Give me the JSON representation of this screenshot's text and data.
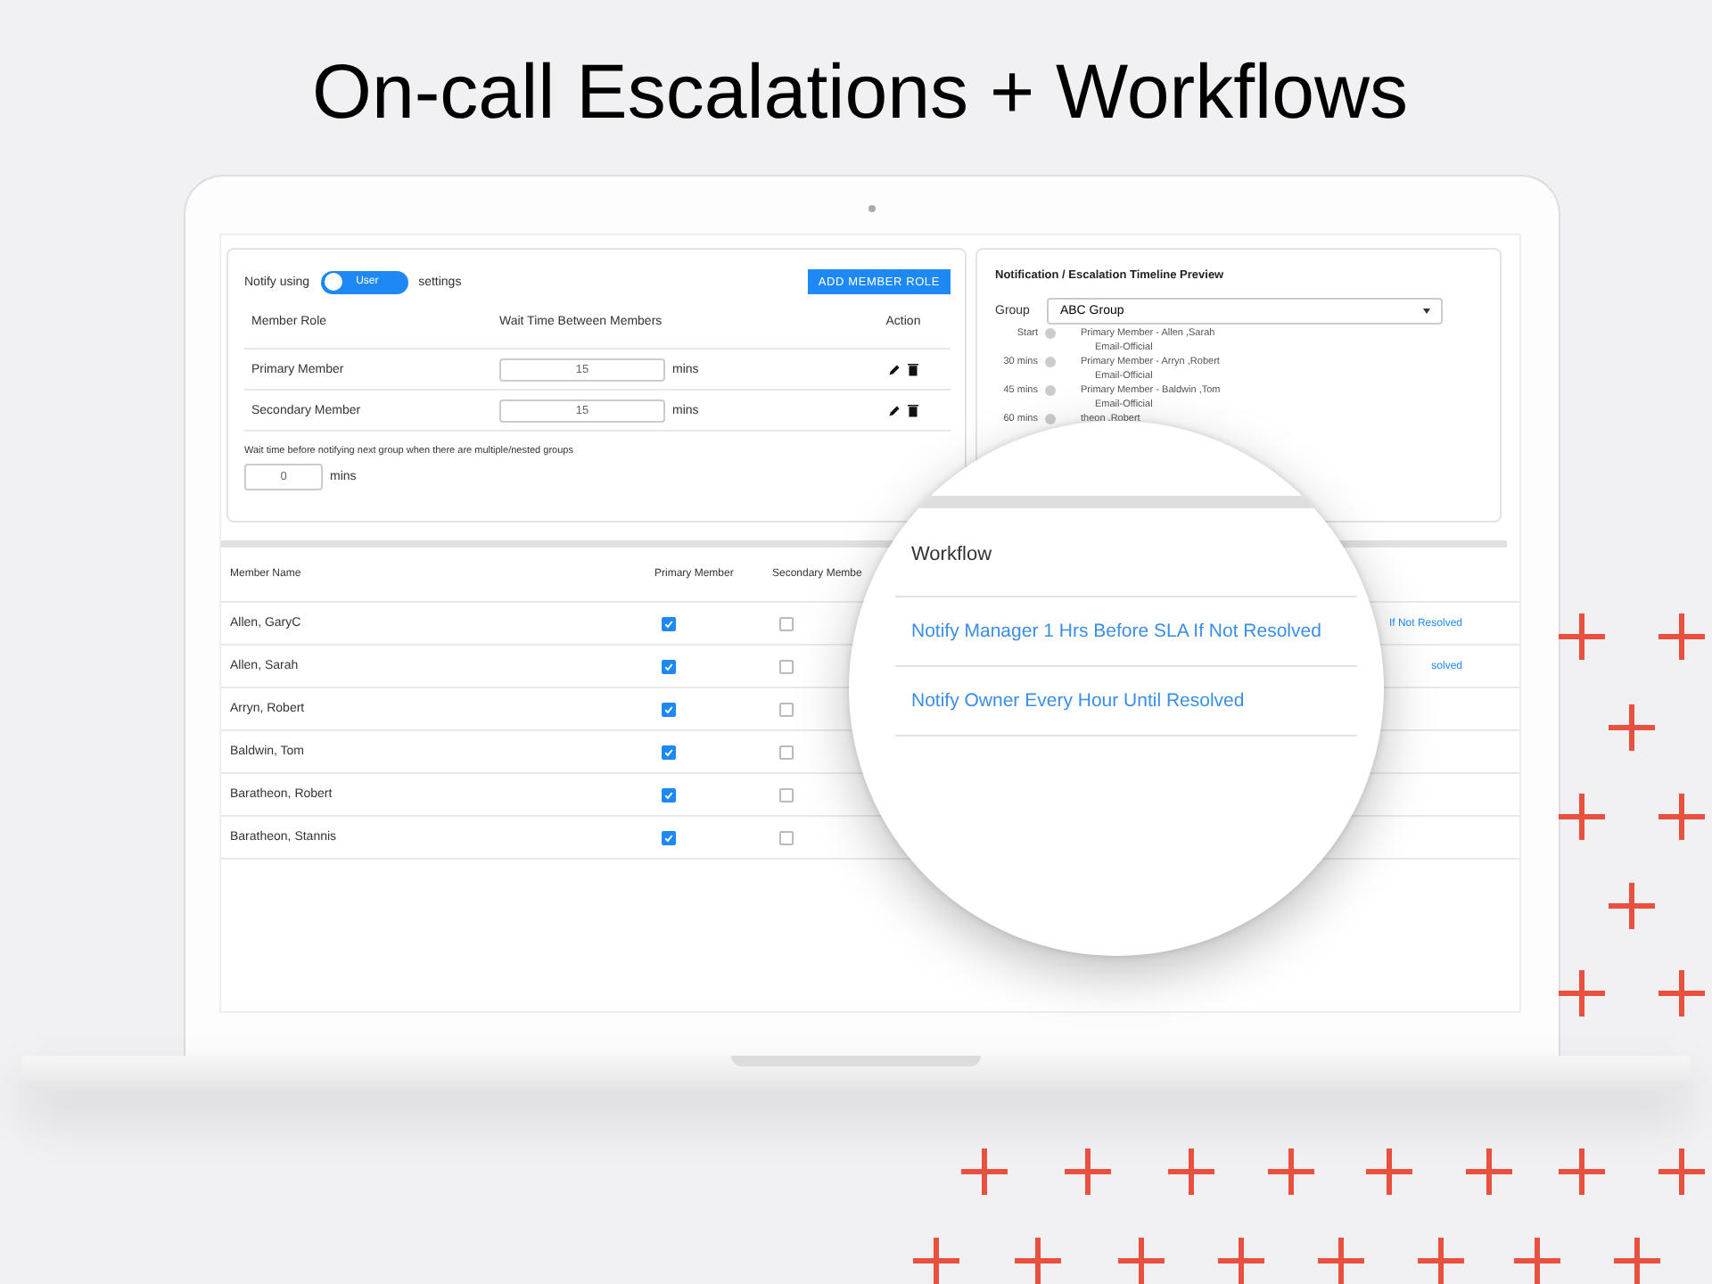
{
  "headline": "On-call Escalations + Workflows",
  "notify": {
    "prefix": "Notify using",
    "toggle_label": "User",
    "suffix": "settings"
  },
  "add_button": "ADD MEMBER ROLE",
  "roles": {
    "columns": [
      "Member Role",
      "Wait Time Between Members",
      "Action"
    ],
    "rows": [
      {
        "role": "Primary Member",
        "wait": "15",
        "unit": "mins"
      },
      {
        "role": "Secondary Member",
        "wait": "15",
        "unit": "mins"
      }
    ]
  },
  "group_wait": {
    "label": "Wait time before notifying next group when there are multiple/nested groups",
    "value": "0",
    "unit": "mins"
  },
  "timeline": {
    "title": "Notification / Escalation Timeline Preview",
    "group_label": "Group",
    "group_value": "ABC Group",
    "steps": [
      {
        "time": "Start",
        "member": "Primary Member - Allen ,Sarah",
        "channel": "Email-Official"
      },
      {
        "time": "30 mins",
        "member": "Primary Member - Arryn ,Robert",
        "channel": "Email-Official"
      },
      {
        "time": "45 mins",
        "member": "Primary Member - Baldwin ,Tom",
        "channel": "Email-Official"
      },
      {
        "time": "60 mins",
        "member": "theon ,Robert"
      }
    ]
  },
  "members": {
    "columns": [
      "Member Name",
      "Primary Member",
      "Secondary Membe"
    ],
    "rows": [
      {
        "name": "Allen, GaryC",
        "primary": true,
        "secondary": false,
        "workflow": "If Not Resolved"
      },
      {
        "name": "Allen, Sarah",
        "primary": true,
        "secondary": false,
        "workflow": "solved"
      },
      {
        "name": "Arryn, Robert",
        "primary": true,
        "secondary": false
      },
      {
        "name": "Baldwin, Tom",
        "primary": true,
        "secondary": false
      },
      {
        "name": "Baratheon, Robert",
        "primary": true,
        "secondary": false
      },
      {
        "name": "Baratheon, Stannis",
        "primary": true,
        "secondary": false
      }
    ]
  },
  "magnifier": {
    "header": "Workflow",
    "links": [
      "Notify Manager 1 Hrs Before SLA If Not Resolved",
      "Notify Owner Every Hour Until Resolved"
    ]
  }
}
